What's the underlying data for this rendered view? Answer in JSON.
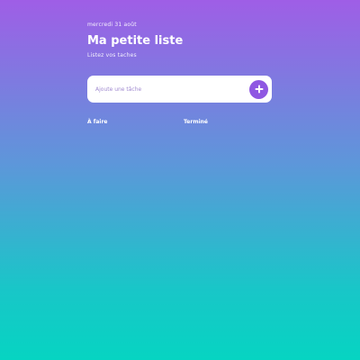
{
  "header": {
    "date": "mercredi 31 août",
    "title": "Ma petite liste",
    "subtitle": "Listez vos taches"
  },
  "add_task": {
    "placeholder": "Ajoute une tâche",
    "button_icon": "plus-circle-icon",
    "accent_color": "#8f58e2"
  },
  "tabs": [
    {
      "label": "À faire"
    },
    {
      "label": "Terminé"
    }
  ],
  "colors": {
    "gradient_top": "#9f5ee6",
    "gradient_bottom": "#06d4c2"
  }
}
